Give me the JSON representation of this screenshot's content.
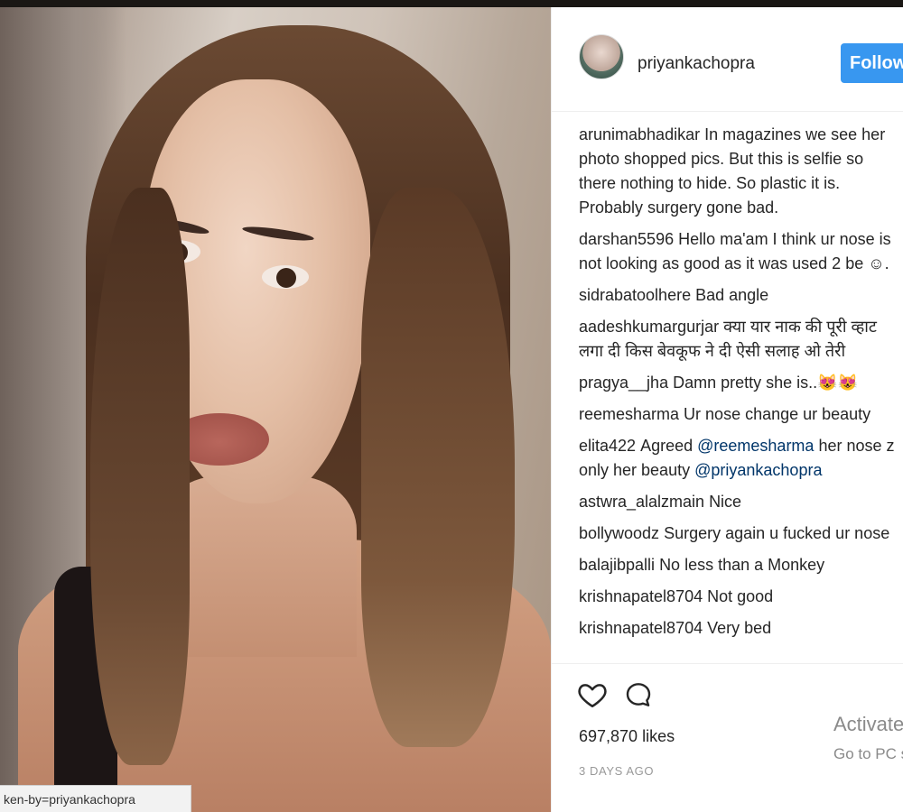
{
  "post": {
    "username": "priyankachopra",
    "follow_label": "Follow"
  },
  "comments": [
    {
      "user": "arunimabhadikar",
      "text": "In magazines we see her photo shopped pics. But this is selfie so there nothing to hide. So plastic it is. Probably surgery gone bad."
    },
    {
      "user": "darshan5596",
      "text": "Hello ma'am I think ur nose is not looking as good as it was used 2 be ☺."
    },
    {
      "user": "sidrabatoolhere",
      "text": "Bad angle"
    },
    {
      "user": "aadeshkumargurjar",
      "text": "क्या यार नाक की पूरी व्हाट लगा दी किस बेवकूफ ने दी ऐसी सलाह ओ तेरी"
    },
    {
      "user": "pragya__jha",
      "text": "Damn pretty she is..😻😻"
    },
    {
      "user": "reemesharma",
      "text": "Ur nose change ur beauty"
    },
    {
      "user": "elita422",
      "text_a": "Agreed",
      "mention_a": "@reemesharma",
      "text_b": "her nose z only her beauty",
      "mention_b": "@priyankachopra"
    },
    {
      "user": "astwra_alalzmain",
      "text": "Nice"
    },
    {
      "user": "bollywoodz",
      "text": "Surgery again u fucked ur nose"
    },
    {
      "user": "balajibpalli",
      "text": "No less than a Monkey"
    },
    {
      "user": "krishnapatel8704",
      "text": "Not good"
    },
    {
      "user": "krishnapatel8704",
      "text": "Very bed"
    }
  ],
  "footer": {
    "likes": "697,870 likes",
    "time_ago": "3 DAYS AGO"
  },
  "status_url": "ken-by=priyankachopra",
  "watermark": {
    "line1": "Activate",
    "line2": "Go to PC s"
  },
  "icons": {
    "like": "heart-icon",
    "comment": "comment-bubble-icon"
  },
  "colors": {
    "follow_button": "#3897f0",
    "mention": "#003569"
  }
}
